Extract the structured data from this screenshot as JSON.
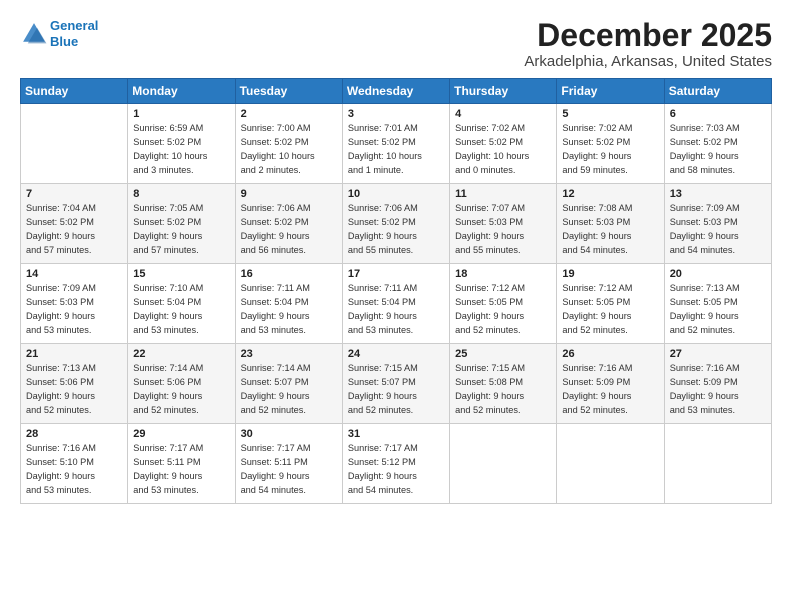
{
  "logo": {
    "line1": "General",
    "line2": "Blue"
  },
  "title": "December 2025",
  "subtitle": "Arkadelphia, Arkansas, United States",
  "days_of_week": [
    "Sunday",
    "Monday",
    "Tuesday",
    "Wednesday",
    "Thursday",
    "Friday",
    "Saturday"
  ],
  "weeks": [
    [
      {
        "num": "",
        "content": ""
      },
      {
        "num": "1",
        "content": "Sunrise: 6:59 AM\nSunset: 5:02 PM\nDaylight: 10 hours\nand 3 minutes."
      },
      {
        "num": "2",
        "content": "Sunrise: 7:00 AM\nSunset: 5:02 PM\nDaylight: 10 hours\nand 2 minutes."
      },
      {
        "num": "3",
        "content": "Sunrise: 7:01 AM\nSunset: 5:02 PM\nDaylight: 10 hours\nand 1 minute."
      },
      {
        "num": "4",
        "content": "Sunrise: 7:02 AM\nSunset: 5:02 PM\nDaylight: 10 hours\nand 0 minutes."
      },
      {
        "num": "5",
        "content": "Sunrise: 7:02 AM\nSunset: 5:02 PM\nDaylight: 9 hours\nand 59 minutes."
      },
      {
        "num": "6",
        "content": "Sunrise: 7:03 AM\nSunset: 5:02 PM\nDaylight: 9 hours\nand 58 minutes."
      }
    ],
    [
      {
        "num": "7",
        "content": "Sunrise: 7:04 AM\nSunset: 5:02 PM\nDaylight: 9 hours\nand 57 minutes."
      },
      {
        "num": "8",
        "content": "Sunrise: 7:05 AM\nSunset: 5:02 PM\nDaylight: 9 hours\nand 57 minutes."
      },
      {
        "num": "9",
        "content": "Sunrise: 7:06 AM\nSunset: 5:02 PM\nDaylight: 9 hours\nand 56 minutes."
      },
      {
        "num": "10",
        "content": "Sunrise: 7:06 AM\nSunset: 5:02 PM\nDaylight: 9 hours\nand 55 minutes."
      },
      {
        "num": "11",
        "content": "Sunrise: 7:07 AM\nSunset: 5:03 PM\nDaylight: 9 hours\nand 55 minutes."
      },
      {
        "num": "12",
        "content": "Sunrise: 7:08 AM\nSunset: 5:03 PM\nDaylight: 9 hours\nand 54 minutes."
      },
      {
        "num": "13",
        "content": "Sunrise: 7:09 AM\nSunset: 5:03 PM\nDaylight: 9 hours\nand 54 minutes."
      }
    ],
    [
      {
        "num": "14",
        "content": "Sunrise: 7:09 AM\nSunset: 5:03 PM\nDaylight: 9 hours\nand 53 minutes."
      },
      {
        "num": "15",
        "content": "Sunrise: 7:10 AM\nSunset: 5:04 PM\nDaylight: 9 hours\nand 53 minutes."
      },
      {
        "num": "16",
        "content": "Sunrise: 7:11 AM\nSunset: 5:04 PM\nDaylight: 9 hours\nand 53 minutes."
      },
      {
        "num": "17",
        "content": "Sunrise: 7:11 AM\nSunset: 5:04 PM\nDaylight: 9 hours\nand 53 minutes."
      },
      {
        "num": "18",
        "content": "Sunrise: 7:12 AM\nSunset: 5:05 PM\nDaylight: 9 hours\nand 52 minutes."
      },
      {
        "num": "19",
        "content": "Sunrise: 7:12 AM\nSunset: 5:05 PM\nDaylight: 9 hours\nand 52 minutes."
      },
      {
        "num": "20",
        "content": "Sunrise: 7:13 AM\nSunset: 5:05 PM\nDaylight: 9 hours\nand 52 minutes."
      }
    ],
    [
      {
        "num": "21",
        "content": "Sunrise: 7:13 AM\nSunset: 5:06 PM\nDaylight: 9 hours\nand 52 minutes."
      },
      {
        "num": "22",
        "content": "Sunrise: 7:14 AM\nSunset: 5:06 PM\nDaylight: 9 hours\nand 52 minutes."
      },
      {
        "num": "23",
        "content": "Sunrise: 7:14 AM\nSunset: 5:07 PM\nDaylight: 9 hours\nand 52 minutes."
      },
      {
        "num": "24",
        "content": "Sunrise: 7:15 AM\nSunset: 5:07 PM\nDaylight: 9 hours\nand 52 minutes."
      },
      {
        "num": "25",
        "content": "Sunrise: 7:15 AM\nSunset: 5:08 PM\nDaylight: 9 hours\nand 52 minutes."
      },
      {
        "num": "26",
        "content": "Sunrise: 7:16 AM\nSunset: 5:09 PM\nDaylight: 9 hours\nand 52 minutes."
      },
      {
        "num": "27",
        "content": "Sunrise: 7:16 AM\nSunset: 5:09 PM\nDaylight: 9 hours\nand 53 minutes."
      }
    ],
    [
      {
        "num": "28",
        "content": "Sunrise: 7:16 AM\nSunset: 5:10 PM\nDaylight: 9 hours\nand 53 minutes."
      },
      {
        "num": "29",
        "content": "Sunrise: 7:17 AM\nSunset: 5:11 PM\nDaylight: 9 hours\nand 53 minutes."
      },
      {
        "num": "30",
        "content": "Sunrise: 7:17 AM\nSunset: 5:11 PM\nDaylight: 9 hours\nand 54 minutes."
      },
      {
        "num": "31",
        "content": "Sunrise: 7:17 AM\nSunset: 5:12 PM\nDaylight: 9 hours\nand 54 minutes."
      },
      {
        "num": "",
        "content": ""
      },
      {
        "num": "",
        "content": ""
      },
      {
        "num": "",
        "content": ""
      }
    ]
  ]
}
